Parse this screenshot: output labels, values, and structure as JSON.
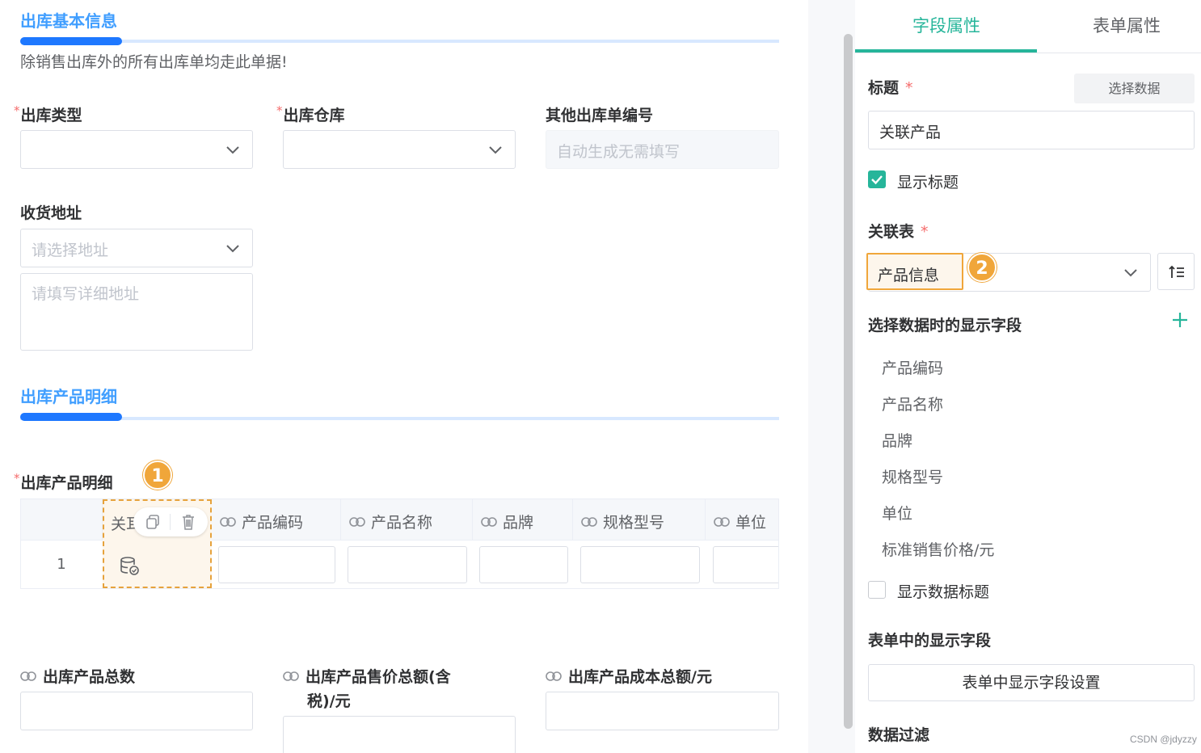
{
  "form": {
    "section1_title": "出库基本信息",
    "hint": "除销售出库外的所有出库单均走此单据!",
    "out_type_label": "出库类型",
    "warehouse_label": "出库仓库",
    "other_no_label": "其他出库单编号",
    "other_no_placeholder": "自动生成无需填写",
    "address_label": "收货地址",
    "address_select_placeholder": "请选择地址",
    "address_detail_placeholder": "请填写详细地址",
    "section2_title": "出库产品明细",
    "detail_label": "出库产品明细",
    "badge1": "1",
    "table": {
      "selected_col_label": "关耳",
      "columns": [
        "产品编码",
        "产品名称",
        "品牌",
        "规格型号",
        "单位"
      ],
      "row_index": "1"
    },
    "total_qty_label": "出库产品总数",
    "total_price_label_line1": "出库产品售价总额(含",
    "total_price_label_line2": "税)/元",
    "total_cost_label": "出库产品成本总额/元"
  },
  "panel": {
    "tabs": [
      "字段属性",
      "表单属性"
    ],
    "active_tab": 0,
    "title_label": "标题",
    "select_data_button": "选择数据",
    "title_value": "关联产品",
    "show_title_label": "显示标题",
    "show_title_checked": true,
    "related_table_label": "关联表",
    "related_table_value": "产品信息",
    "badge2": "2",
    "display_fields_label": "选择数据时的显示字段",
    "display_fields": [
      "产品编码",
      "产品名称",
      "品牌",
      "规格型号",
      "单位",
      "标准销售价格/元"
    ],
    "show_data_title_label": "显示数据标题",
    "show_data_title_checked": false,
    "form_display_fields_label": "表单中的显示字段",
    "form_display_button": "表单中显示字段设置",
    "data_filter_label": "数据过滤"
  },
  "watermark": "CSDN @jdyzzy",
  "colors": {
    "section_blue": "#409eff",
    "accent_green": "#26b59a",
    "highlight_orange": "#f0a63a",
    "required_red": "#f56c6c"
  }
}
